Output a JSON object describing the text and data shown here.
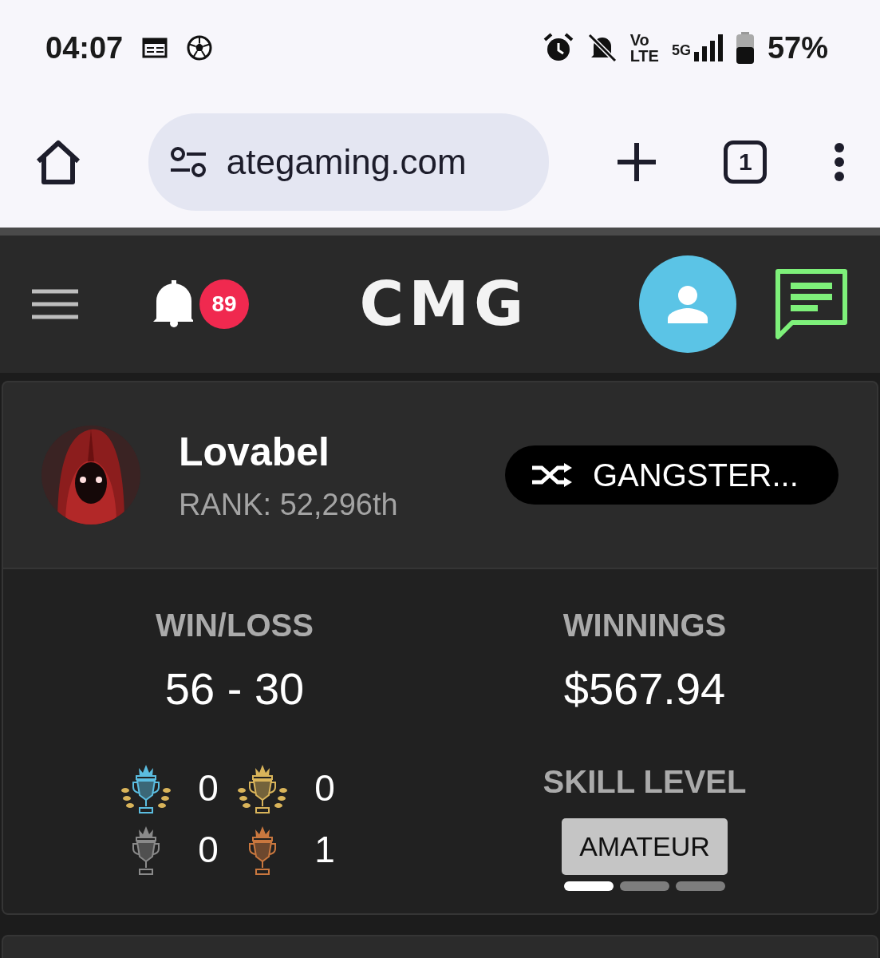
{
  "status_bar": {
    "time": "04:07",
    "volte_top": "Vo",
    "volte_bottom": "LTE",
    "network": "5G",
    "battery": "57%"
  },
  "browser": {
    "url": "ategaming.com",
    "tab_count": "1"
  },
  "header": {
    "notification_count": "89",
    "logo": "CMG"
  },
  "profile": {
    "name": "Lovabel",
    "rank": "RANK: 52,296th",
    "title_button": "GANGSTER..."
  },
  "stats": {
    "win_loss_label": "WIN/LOSS",
    "win_loss": "56 - 30",
    "winnings_label": "WINNINGS",
    "winnings": "$567.94",
    "trophies": [
      {
        "kind": "laurel",
        "color": "#5bbde0",
        "count": "0"
      },
      {
        "kind": "laurel",
        "color": "#d9b45a",
        "count": "0"
      },
      {
        "kind": "plain",
        "color": "#8a8a8a",
        "count": "0"
      },
      {
        "kind": "plain",
        "color": "#c9773e",
        "count": "1"
      }
    ],
    "skill_label": "SKILL LEVEL",
    "skill": "AMATEUR",
    "skill_segments": [
      {
        "on": true
      },
      {
        "on": false
      },
      {
        "on": false
      }
    ]
  }
}
